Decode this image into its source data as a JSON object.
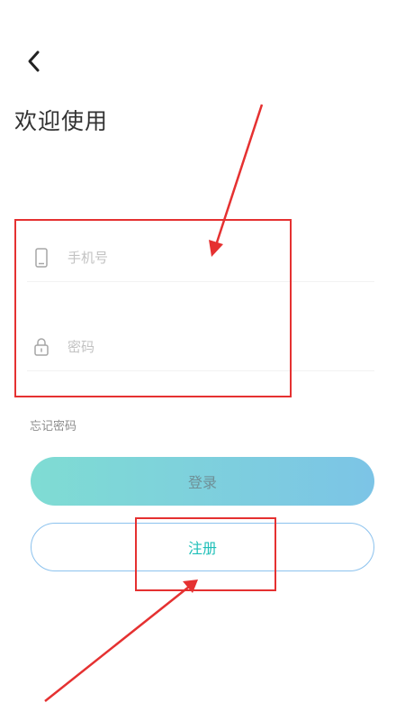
{
  "header": {
    "back_icon": "chevron-left-icon",
    "title": "欢迎使用"
  },
  "form": {
    "phone": {
      "icon": "phone-icon",
      "placeholder": "手机号",
      "value": ""
    },
    "password": {
      "icon": "lock-icon",
      "placeholder": "密码",
      "value": ""
    },
    "forgot_label": "忘记密码"
  },
  "actions": {
    "login_label": "登录",
    "register_label": "注册"
  },
  "colors": {
    "annotation": "#e53131",
    "login_gradient_start": "#7fdcd3",
    "login_gradient_end": "#7cc4e6",
    "register_text": "#1ebfb8",
    "register_border": "#8cc2ee"
  }
}
